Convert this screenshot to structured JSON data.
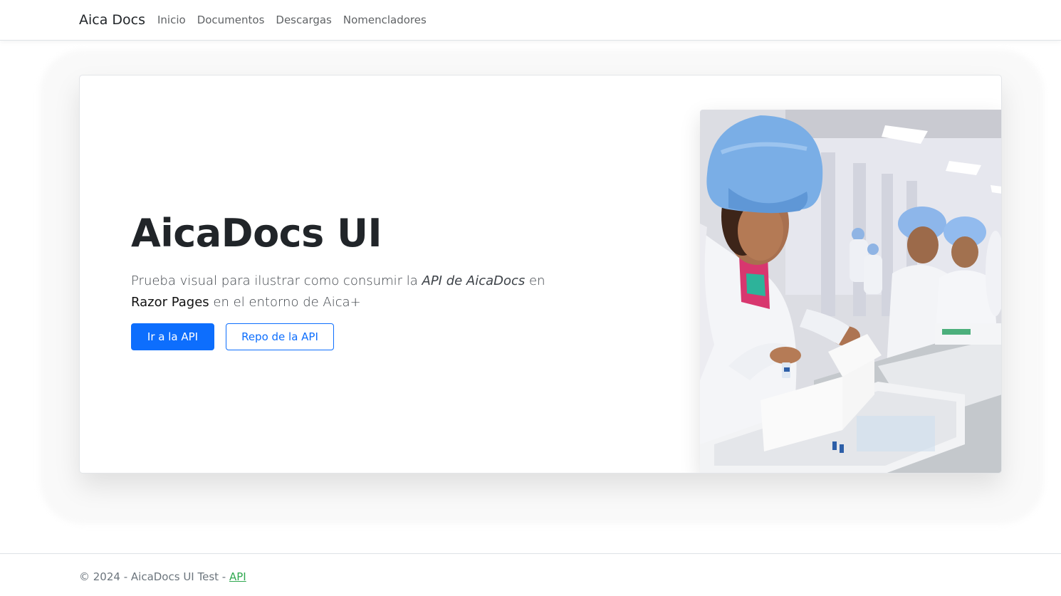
{
  "navbar": {
    "brand": "Aica Docs",
    "links": [
      "Inicio",
      "Documentos",
      "Descargas",
      "Nomencladores"
    ]
  },
  "hero": {
    "title": "AicaDocs UI",
    "lead_part1": "Prueba visual para ilustrar como consumir la ",
    "lead_em": "API de AicaDocs",
    "lead_part2": " en ",
    "lead_strong": "Razor Pages",
    "lead_part3": " en el entorno de Aica+",
    "primary_button": "Ir a la API",
    "secondary_button": "Repo de la API"
  },
  "footer": {
    "text": "© 2024 - AicaDocs UI Test - ",
    "link": "API"
  },
  "colors": {
    "primary": "#0d6efd",
    "footer_link": "#2fa84f"
  }
}
